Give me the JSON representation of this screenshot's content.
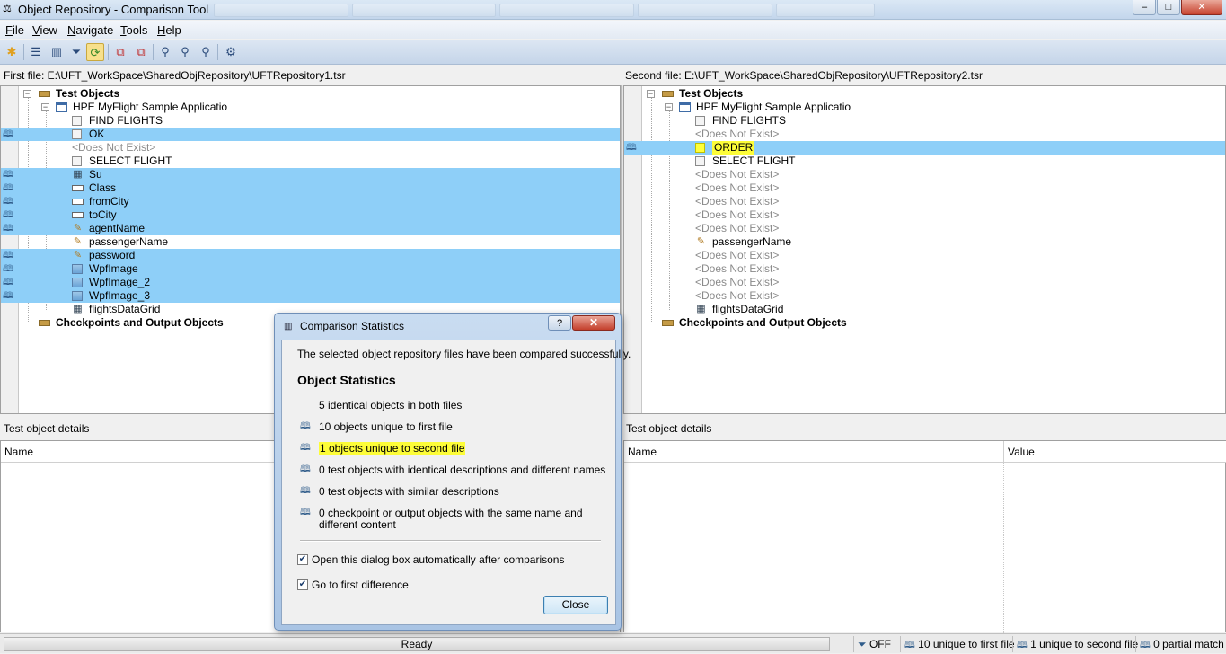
{
  "window": {
    "title": "Object Repository - Comparison Tool",
    "minimize": "–",
    "maximize": "□",
    "close": "✕"
  },
  "menu": [
    "File",
    "View",
    "Navigate",
    "Tools",
    "Help"
  ],
  "left": {
    "file_label": "First file: E:\\UFT_WorkSpace\\SharedObjRepository\\UFTRepository1.tsr",
    "tree": [
      {
        "label": "Test Objects",
        "level": 0,
        "icon": "folder",
        "bold": true,
        "toggle": "−"
      },
      {
        "label": "HPE MyFlight Sample Applicatio",
        "level": 1,
        "icon": "window",
        "toggle": "−"
      },
      {
        "label": "FIND FLIGHTS",
        "level": 2,
        "icon": "button"
      },
      {
        "label": "OK",
        "level": 2,
        "icon": "button",
        "hl": true,
        "mark": true
      },
      {
        "label": "<Does Not Exist>",
        "level": 2,
        "gray": true
      },
      {
        "label": "SELECT FLIGHT",
        "level": 2,
        "icon": "button"
      },
      {
        "label": "Su",
        "level": 2,
        "icon": "table",
        "hl": true,
        "mark": true
      },
      {
        "label": "Class",
        "level": 2,
        "icon": "combo",
        "hl": true,
        "mark": true
      },
      {
        "label": "fromCity",
        "level": 2,
        "icon": "combo",
        "hl": true,
        "mark": true
      },
      {
        "label": "toCity",
        "level": 2,
        "icon": "combo",
        "hl": true,
        "mark": true
      },
      {
        "label": "agentName",
        "level": 2,
        "icon": "edit",
        "hl": true,
        "mark": true
      },
      {
        "label": "passengerName",
        "level": 2,
        "icon": "edit"
      },
      {
        "label": "password",
        "level": 2,
        "icon": "edit",
        "hl": true,
        "mark": true
      },
      {
        "label": "WpfImage",
        "level": 2,
        "icon": "image",
        "hl": true,
        "mark": true
      },
      {
        "label": "WpfImage_2",
        "level": 2,
        "icon": "image",
        "hl": true,
        "mark": true
      },
      {
        "label": "WpfImage_3",
        "level": 2,
        "icon": "image",
        "hl": true,
        "mark": true
      },
      {
        "label": "flightsDataGrid",
        "level": 2,
        "icon": "table"
      },
      {
        "label": "Checkpoints and Output Objects",
        "level": 0,
        "icon": "folder",
        "bold": true
      }
    ]
  },
  "right": {
    "file_label": "Second file: E:\\UFT_WorkSpace\\SharedObjRepository\\UFTRepository2.tsr",
    "tree": [
      {
        "label": "Test Objects",
        "level": 0,
        "icon": "folder",
        "bold": true,
        "toggle": "−"
      },
      {
        "label": "HPE MyFlight Sample Applicatio",
        "level": 1,
        "icon": "window",
        "toggle": "−"
      },
      {
        "label": "FIND FLIGHTS",
        "level": 2,
        "icon": "button"
      },
      {
        "label": "<Does Not Exist>",
        "level": 2,
        "gray": true
      },
      {
        "label": "ORDER",
        "level": 2,
        "icon": "button",
        "hl": true,
        "mark": true,
        "yellow": true
      },
      {
        "label": "SELECT FLIGHT",
        "level": 2,
        "icon": "button"
      },
      {
        "label": "<Does Not Exist>",
        "level": 2,
        "gray": true
      },
      {
        "label": "<Does Not Exist>",
        "level": 2,
        "gray": true
      },
      {
        "label": "<Does Not Exist>",
        "level": 2,
        "gray": true
      },
      {
        "label": "<Does Not Exist>",
        "level": 2,
        "gray": true
      },
      {
        "label": "<Does Not Exist>",
        "level": 2,
        "gray": true
      },
      {
        "label": "passengerName",
        "level": 2,
        "icon": "edit"
      },
      {
        "label": "<Does Not Exist>",
        "level": 2,
        "gray": true
      },
      {
        "label": "<Does Not Exist>",
        "level": 2,
        "gray": true
      },
      {
        "label": "<Does Not Exist>",
        "level": 2,
        "gray": true
      },
      {
        "label": "<Does Not Exist>",
        "level": 2,
        "gray": true
      },
      {
        "label": "flightsDataGrid",
        "level": 2,
        "icon": "table"
      },
      {
        "label": "Checkpoints and Output Objects",
        "level": 0,
        "icon": "folder",
        "bold": true
      }
    ]
  },
  "details": {
    "left_label": "Test object details",
    "right_label": "Test object details",
    "col_name": "Name",
    "col_value": "Value"
  },
  "status": {
    "ready": "Ready",
    "filter": "OFF",
    "unique_first": "10 unique to first file",
    "unique_second": "1 unique to second file",
    "partial": "0 partial match"
  },
  "dialog": {
    "title": "Comparison Statistics",
    "help": "?",
    "close_x": "✕",
    "message": "The selected object repository files have been compared successfully.",
    "heading": "Object Statistics",
    "stats": [
      "5 identical objects in both files",
      "10 objects unique to first file",
      "1 objects unique to second file",
      "0 test objects with identical descriptions and different names",
      "0 test objects with similar descriptions",
      "0 checkpoint or output objects with the same name and",
      "different content"
    ],
    "option_auto": "Open this dialog box automatically after comparisons",
    "option_first_diff": "Go to first difference",
    "close_button": "Close"
  },
  "colors": {
    "highlight": "#8ecff8",
    "yellow_marker": "#fdfd38",
    "title_gradient": "#c3d6ec"
  }
}
